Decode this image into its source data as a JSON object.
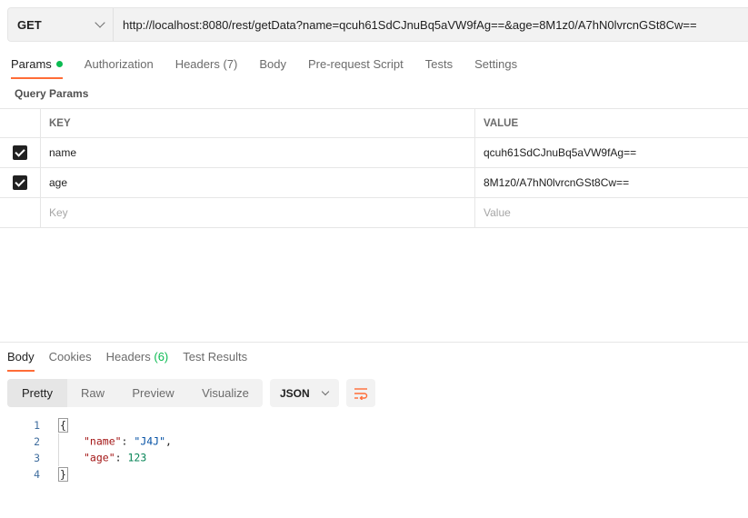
{
  "request": {
    "method": "GET",
    "url": "http://localhost:8080/rest/getData?name=qcuh61SdCJnuBq5aVW9fAg==&age=8M1z0/A7hN0lvrcnGSt8Cw=="
  },
  "request_tabs": [
    {
      "label": "Params",
      "active": true,
      "indicator": "green-dot"
    },
    {
      "label": "Authorization"
    },
    {
      "label": "Headers",
      "count": "(7)"
    },
    {
      "label": "Body"
    },
    {
      "label": "Pre-request Script"
    },
    {
      "label": "Tests"
    },
    {
      "label": "Settings"
    }
  ],
  "params": {
    "section_title": "Query Params",
    "columns": {
      "key": "KEY",
      "value": "VALUE"
    },
    "rows": [
      {
        "checked": true,
        "key": "name",
        "value": "qcuh61SdCJnuBq5aVW9fAg=="
      },
      {
        "checked": true,
        "key": "age",
        "value": "8M1z0/A7hN0lvrcnGSt8Cw=="
      }
    ],
    "placeholder": {
      "key": "Key",
      "value": "Value"
    }
  },
  "response_tabs": [
    {
      "label": "Body",
      "active": true
    },
    {
      "label": "Cookies"
    },
    {
      "label": "Headers",
      "count": "(6)"
    },
    {
      "label": "Test Results"
    }
  ],
  "view_modes": [
    "Pretty",
    "Raw",
    "Preview",
    "Visualize"
  ],
  "active_view": "Pretty",
  "format": "JSON",
  "code": {
    "line_numbers": [
      "1",
      "2",
      "3",
      "4"
    ],
    "open_brace": "{",
    "close_brace": "}",
    "entries": [
      {
        "key": "\"name\"",
        "value": "\"J4J\"",
        "trail": ","
      },
      {
        "key": "\"age\"",
        "value": "123",
        "trail": ""
      }
    ]
  },
  "colors": {
    "accent": "#ff6c37",
    "success": "#0cbb52",
    "json_key": "#a31515",
    "json_string": "#0451a5",
    "json_number": "#098658"
  }
}
